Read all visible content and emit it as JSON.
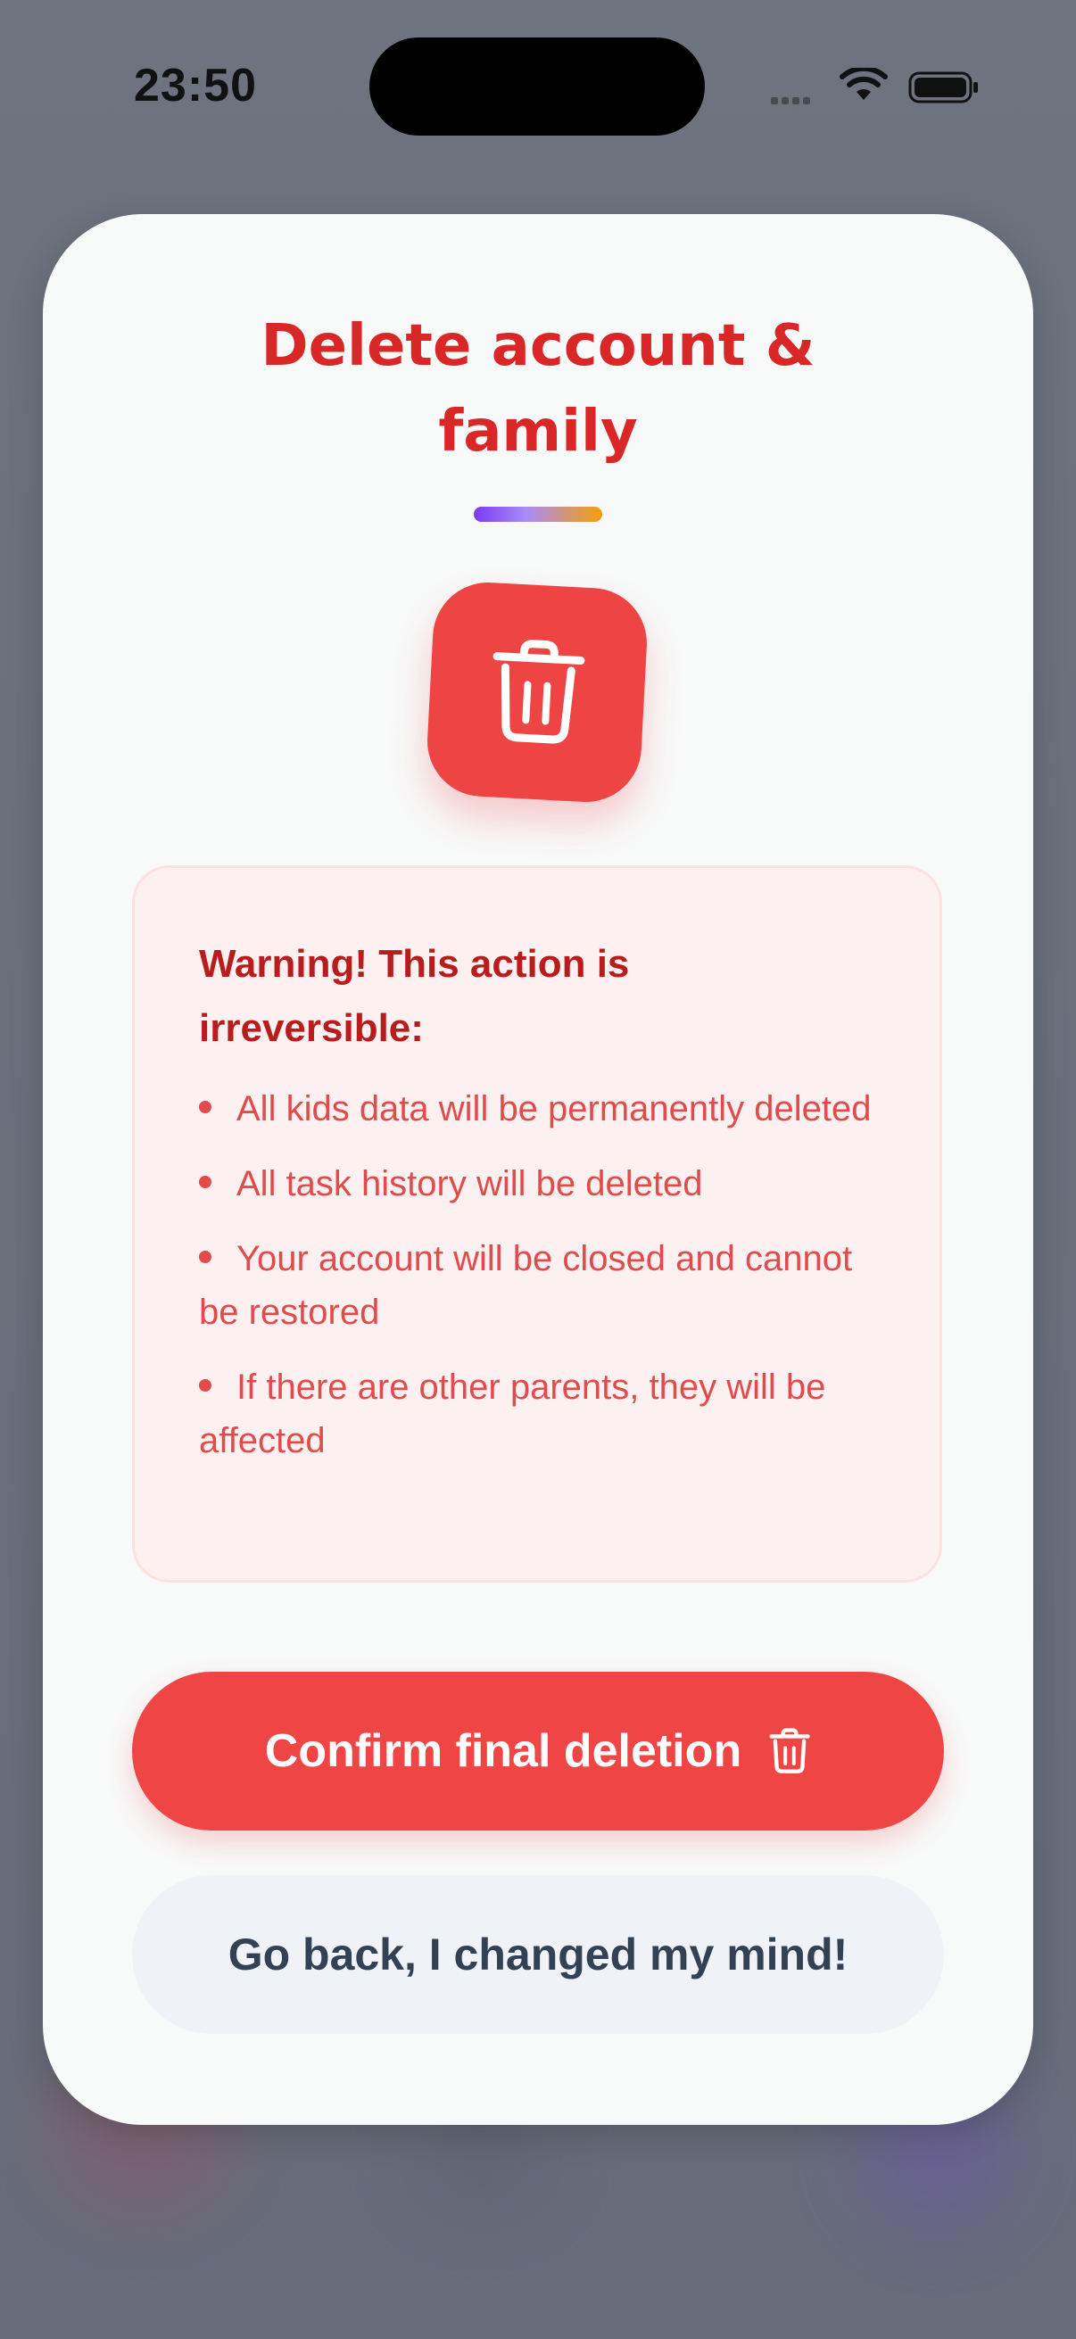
{
  "status_bar": {
    "time": "23:50"
  },
  "dialog": {
    "title_line1": "Delete account &",
    "title_line2": "family",
    "warning": {
      "title": "Warning! This action is irreversible:",
      "items": [
        "All kids data will be permanently deleted",
        "All task history will be deleted",
        "Your account will be closed and cannot be restored",
        "If there are other parents, they will be affected"
      ]
    },
    "confirm_label": "Confirm final deletion",
    "back_label": "Go back, I changed my mind!"
  },
  "colors": {
    "danger": "#ef4444",
    "title": "#d92626",
    "warning_bg": "#fdf0f0",
    "warning_text": "#e14b4b",
    "secondary_bg": "#eff3f8"
  },
  "icons": {
    "header": "trash-icon",
    "confirm": "trash-icon"
  }
}
